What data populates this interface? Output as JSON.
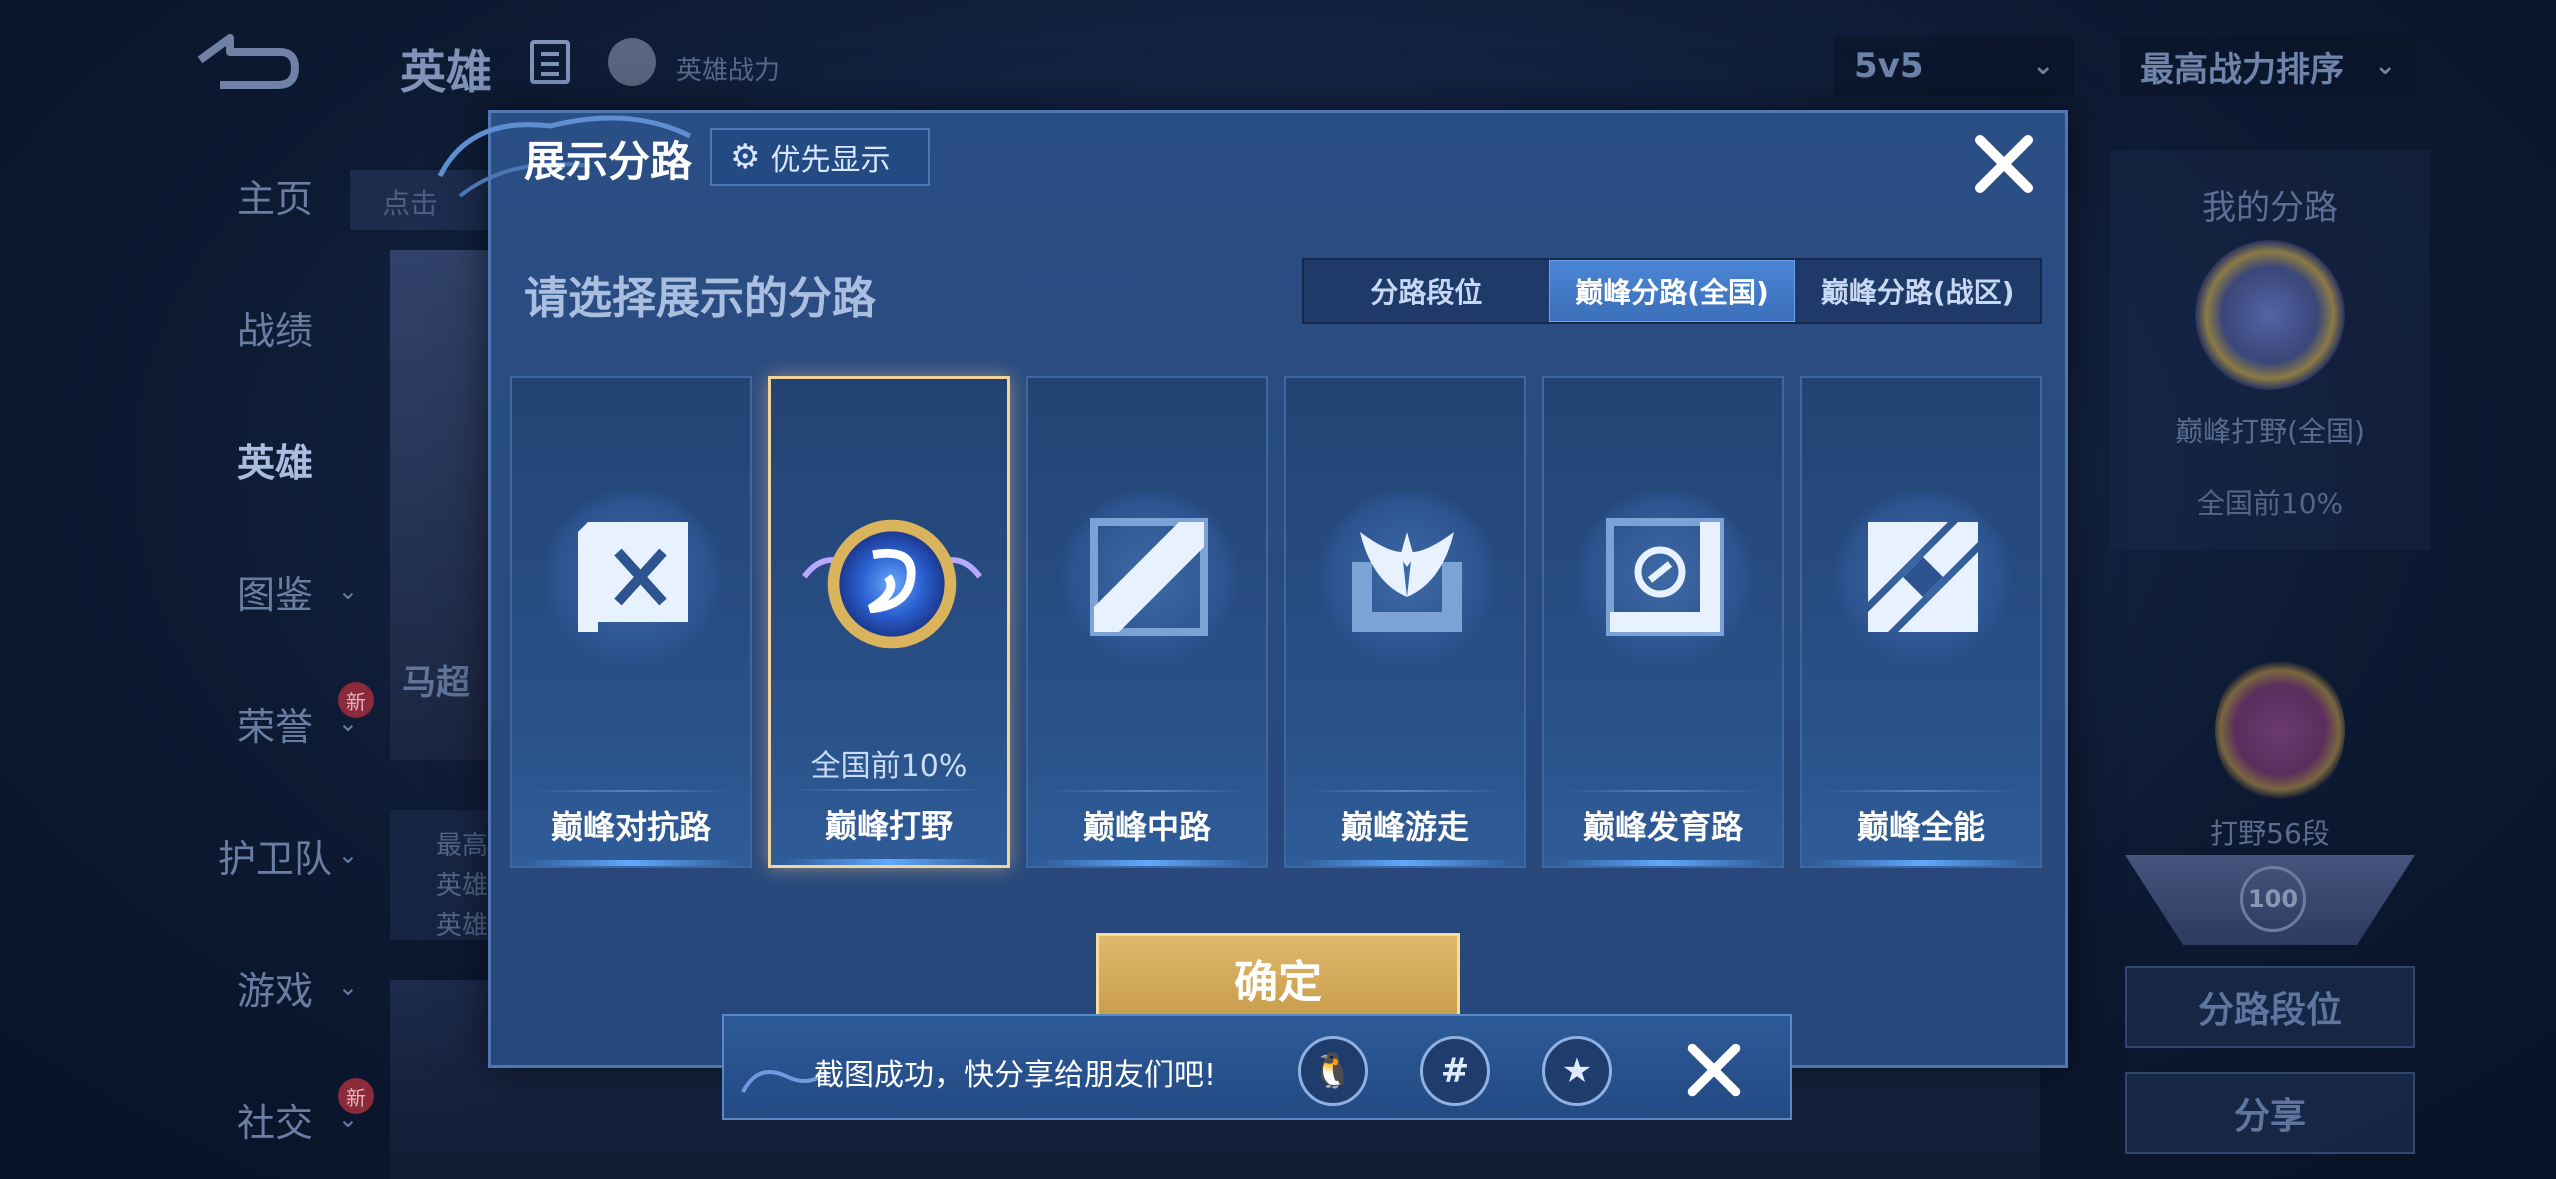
{
  "background": {
    "top_title": "英雄",
    "hero_power_label": "英雄战力",
    "mode_select": "5v5",
    "sort_select": "最高战力排序",
    "search_placeholder": "点击",
    "nav": [
      {
        "label": "主页",
        "has_chevron": false,
        "badge": ""
      },
      {
        "label": "战绩",
        "has_chevron": false,
        "badge": ""
      },
      {
        "label": "英雄",
        "has_chevron": false,
        "badge": "",
        "active": true
      },
      {
        "label": "图鉴",
        "has_chevron": true,
        "badge": ""
      },
      {
        "label": "荣誉",
        "has_chevron": true,
        "badge": "新"
      },
      {
        "label": "护卫队",
        "has_chevron": true,
        "badge": ""
      },
      {
        "label": "游戏",
        "has_chevron": true,
        "badge": ""
      },
      {
        "label": "社交",
        "has_chevron": true,
        "badge": "新"
      }
    ],
    "hero_card_name": "马超",
    "hero_stats_lines": [
      "最高",
      "英雄",
      "英雄"
    ],
    "right_panel": {
      "title": "我的分路",
      "badge_label": "巅峰打野(全国)",
      "badge_rank": "全国前10%",
      "second_badge_label": "打野56段",
      "level": "100",
      "buttons": [
        "分路段位",
        "分享"
      ]
    }
  },
  "modal": {
    "title": "展示分路",
    "priority_button": "优先显示",
    "prompt": "请选择展示的分路",
    "tabs": [
      {
        "label": "分路段位",
        "active": false
      },
      {
        "label": "巅峰分路(全国)",
        "active": true
      },
      {
        "label": "巅峰分路(战区)",
        "active": false
      }
    ],
    "lanes": [
      {
        "name": "巅峰对抗路",
        "icon": "clash-lane-icon",
        "selected": false,
        "rank": ""
      },
      {
        "name": "巅峰打野",
        "icon": "jungle-badge-icon",
        "selected": true,
        "rank": "全国前10%"
      },
      {
        "name": "巅峰中路",
        "icon": "mid-lane-icon",
        "selected": false,
        "rank": ""
      },
      {
        "name": "巅峰游走",
        "icon": "roam-icon",
        "selected": false,
        "rank": ""
      },
      {
        "name": "巅峰发育路",
        "icon": "farm-lane-icon",
        "selected": false,
        "rank": ""
      },
      {
        "name": "巅峰全能",
        "icon": "all-round-icon",
        "selected": false,
        "rank": ""
      }
    ],
    "confirm_button": "确定"
  },
  "toast": {
    "message": "截图成功，快分享给朋友们吧!",
    "share_targets": [
      {
        "name": "qq-icon",
        "glyph": "🐧"
      },
      {
        "name": "wechat-moments-icon",
        "glyph": "#"
      },
      {
        "name": "qzone-icon",
        "glyph": "★"
      }
    ]
  },
  "colors": {
    "modal_bg": "#2a4f86",
    "tab_active": "#4a86d6",
    "selected_border": "#f2d39a",
    "confirm_gold": "#d3a85c"
  }
}
